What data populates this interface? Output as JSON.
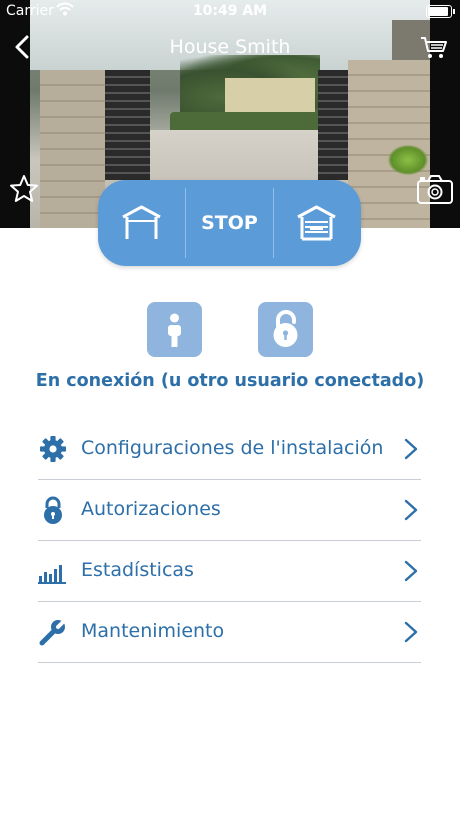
{
  "status_bar": {
    "carrier": "Carrier",
    "time": "10:49 AM"
  },
  "nav": {
    "title": "House Smith"
  },
  "controls": {
    "stop_label": "STOP"
  },
  "connection_status": "En conexión (u otro usuario conectado)",
  "menu": [
    {
      "label": "Configuraciones de l'instalación",
      "icon": "gear-icon"
    },
    {
      "label": "Autorizaciones",
      "icon": "lock-icon"
    },
    {
      "label": "Estadísticas",
      "icon": "bar-chart-icon"
    },
    {
      "label": "Mantenimiento",
      "icon": "wrench-icon"
    }
  ],
  "colors": {
    "accent": "#2d6fa8",
    "pill": "#5b9bd8",
    "action_tile": "#8fb4dd",
    "divider": "#c8ced4"
  }
}
